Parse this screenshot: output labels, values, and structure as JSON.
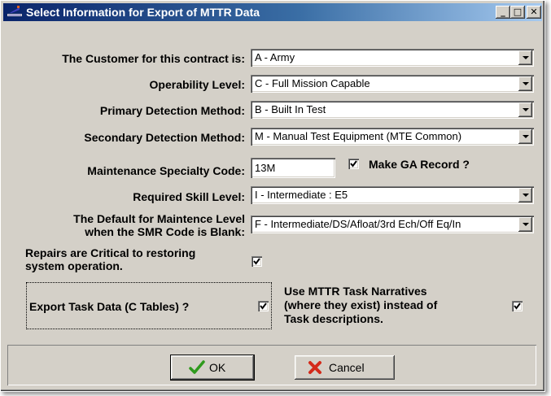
{
  "window": {
    "title": "Select Information for Export of MTTR Data",
    "minimize_glyph": "_",
    "maximize_glyph": "□",
    "close_glyph": "✕"
  },
  "fields": {
    "customer": {
      "label": "The Customer for this contract is:",
      "value": "A - Army"
    },
    "operability": {
      "label": "Operability Level:",
      "value": "C - Full Mission Capable"
    },
    "primary_detection": {
      "label": "Primary Detection Method:",
      "value": "B - Built In Test"
    },
    "secondary_detection": {
      "label": "Secondary Detection Method:",
      "value": "M - Manual Test Equipment (MTE Common)"
    },
    "specialty_code": {
      "label": "Maintenance Specialty Code:",
      "value": "13M"
    },
    "make_ga": {
      "label": "Make GA Record ?",
      "checked": true
    },
    "skill_level": {
      "label": "Required Skill Level:",
      "value": "I - Intermediate : E5"
    },
    "default_maint": {
      "label_line1": "The Default for Maintence Level",
      "label_line2": "when the SMR Code is Blank:",
      "value": "F - Intermediate/DS/Afloat/3rd Ech/Off Eq/In"
    },
    "repairs_critical": {
      "label_line1": "Repairs are Critical to restoring",
      "label_line2": "system operation.",
      "checked": true
    },
    "export_task": {
      "label": "Export Task Data (C Tables) ?",
      "checked": true
    },
    "use_narratives": {
      "label_line1": "Use MTTR Task Narratives",
      "label_line2": "(where they exist) instead of",
      "label_line3": "Task descriptions.",
      "checked": true
    }
  },
  "buttons": {
    "ok": {
      "label": "OK",
      "icon": "checkmark-icon"
    },
    "cancel": {
      "label": "Cancel",
      "icon": "red-x-icon"
    }
  },
  "colors": {
    "titlebar_start": "#0a246a",
    "titlebar_end": "#a6caf0",
    "dialog_face": "#d4d0c8",
    "ok_icon": "#2e9a1c",
    "cancel_icon": "#d42a1a"
  }
}
